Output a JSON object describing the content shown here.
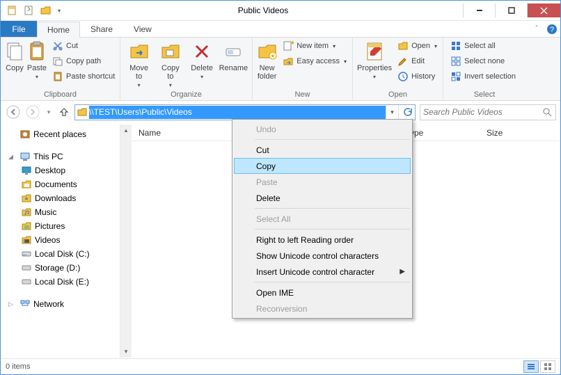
{
  "window": {
    "title": "Public Videos"
  },
  "tabs": {
    "file": "File",
    "home": "Home",
    "share": "Share",
    "view": "View"
  },
  "ribbon": {
    "clipboard": {
      "label": "Clipboard",
      "copy": "Copy",
      "paste": "Paste",
      "cut": "Cut",
      "copy_path": "Copy path",
      "paste_shortcut": "Paste shortcut"
    },
    "organize": {
      "label": "Organize",
      "move_to": "Move\nto",
      "copy_to": "Copy\nto",
      "delete": "Delete",
      "rename": "Rename"
    },
    "new": {
      "label": "New",
      "new_folder": "New\nfolder",
      "new_item": "New item",
      "easy_access": "Easy access"
    },
    "open": {
      "label": "Open",
      "properties": "Properties",
      "open": "Open",
      "edit": "Edit",
      "history": "History"
    },
    "select": {
      "label": "Select",
      "select_all": "Select all",
      "select_none": "Select none",
      "invert": "Invert selection"
    }
  },
  "nav": {
    "address": "\\\\TEST\\Users\\Public\\Videos",
    "search_placeholder": "Search Public Videos"
  },
  "tree": {
    "recent": "Recent places",
    "this_pc": "This PC",
    "desktop": "Desktop",
    "documents": "Documents",
    "downloads": "Downloads",
    "music": "Music",
    "pictures": "Pictures",
    "videos": "Videos",
    "disk_c": "Local Disk (C:)",
    "disk_d": "Storage (D:)",
    "disk_e": "Local Disk (E:)",
    "network": "Network"
  },
  "columns": {
    "name": "Name",
    "type": "ype",
    "size": "Size"
  },
  "status": {
    "items": "0 items"
  },
  "ctx": {
    "undo": "Undo",
    "cut": "Cut",
    "copy": "Copy",
    "paste": "Paste",
    "delete": "Delete",
    "select_all": "Select All",
    "rtl": "Right to left Reading order",
    "show_uni": "Show Unicode control characters",
    "insert_uni": "Insert Unicode control character",
    "open_ime": "Open IME",
    "reconv": "Reconversion"
  }
}
